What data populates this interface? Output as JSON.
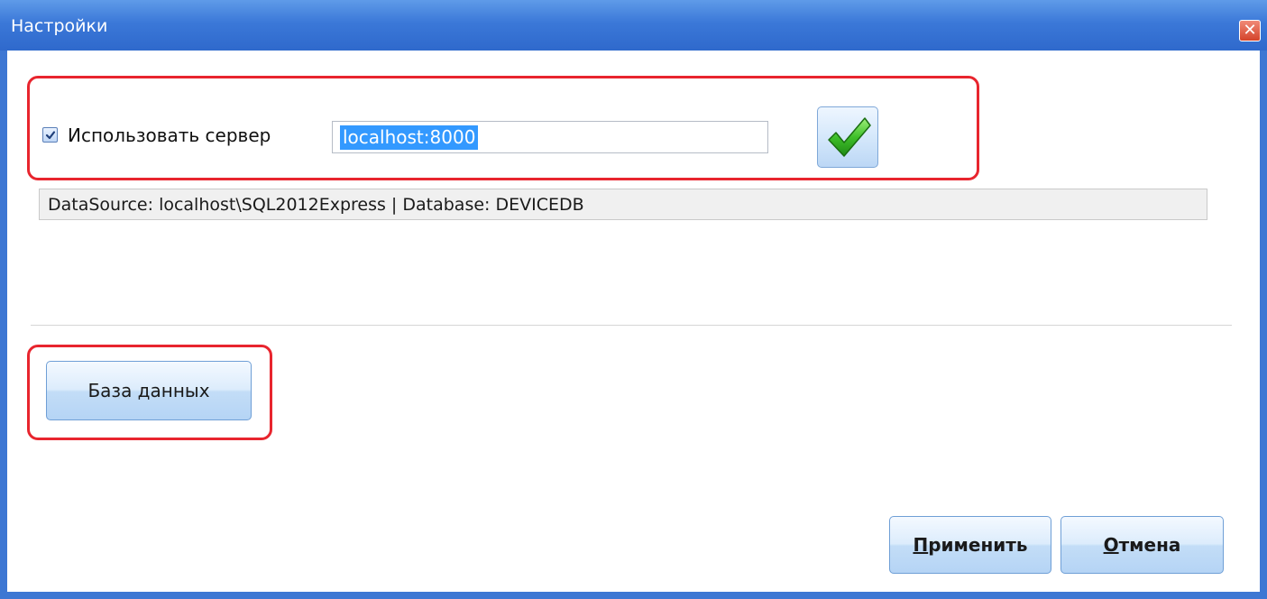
{
  "window": {
    "title": "Настройки",
    "close_icon": "close-icon",
    "accent_color": "#3d77d3",
    "highlight_color": "#e8252e"
  },
  "server": {
    "use_server_label": "Использовать сервер",
    "use_server_checked": true,
    "address_value": "localhost:8000",
    "confirm_icon": "green-checkmark-icon"
  },
  "datasource": {
    "text": "DataSource: localhost\\SQL2012Express | Database: DEVICEDB"
  },
  "database_button": {
    "label": "База данных"
  },
  "footer": {
    "apply_label_first": "П",
    "apply_label_rest": "рименить",
    "cancel_label_first": "О",
    "cancel_label_rest": "тмена"
  }
}
